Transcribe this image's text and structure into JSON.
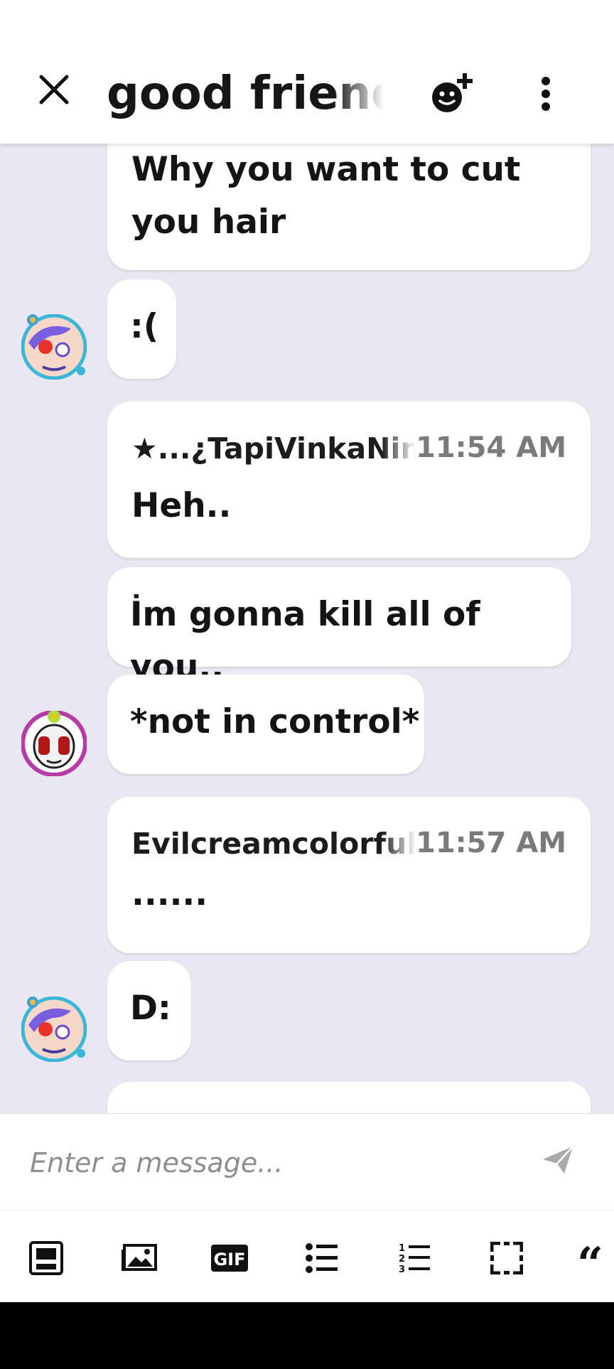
{
  "header": {
    "title": "good friends",
    "close_icon": "close-icon",
    "invite_icon": "add-member-icon",
    "more_icon": "more-vertical-icon"
  },
  "messages": [
    {
      "text_lines": [
        "Why you want to cut",
        "you hair"
      ]
    },
    {
      "text": ":("
    },
    {
      "sender": "★...¿TapiVinkaNina",
      "time": "11:54 AM",
      "text": "Heh.."
    },
    {
      "text": "İm gonna kill all of you.."
    },
    {
      "text": "*not in control*"
    },
    {
      "sender": "EvilcreamcolorfulT",
      "time": "11:57 AM",
      "text": "......"
    },
    {
      "text": "D:"
    }
  ],
  "composer": {
    "placeholder": "Enter a message...",
    "send_icon": "send-icon"
  },
  "toolbar": {
    "items": [
      "sticker-icon",
      "image-icon",
      "gif-icon",
      "bullet-list-icon",
      "numbered-list-icon",
      "select-area-icon",
      "quote-icon"
    ],
    "gif_label": "GIF"
  },
  "colors": {
    "chat_background": "#e9e8f2",
    "bubble": "#ffffff",
    "text": "#141414",
    "timestamp": "#7a7a7a",
    "header": "#ffffff",
    "nav_bar": "#000000"
  }
}
